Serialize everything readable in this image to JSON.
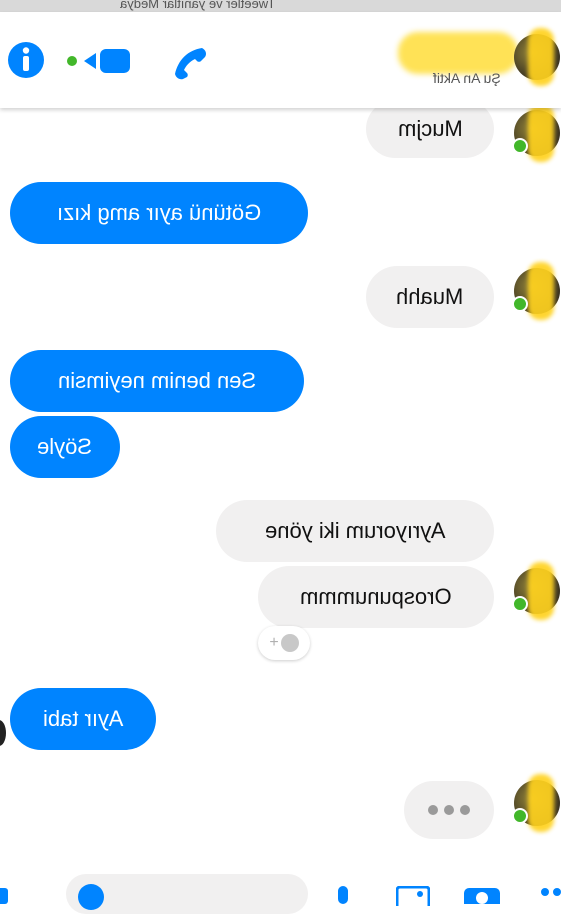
{
  "statusbar": {
    "ghost_text": "Tweetler ve yanıtlar   Medya"
  },
  "header": {
    "status_text": "Şu An Aktif",
    "icons": [
      "info-icon",
      "video-call-icon",
      "phone-icon"
    ],
    "accent": "#0084ff"
  },
  "messages": [
    {
      "id": "m1",
      "side": "in",
      "text": "Mucjm"
    },
    {
      "id": "m2",
      "side": "out",
      "text": "Götünü ayır amg kızı"
    },
    {
      "id": "m3",
      "side": "in",
      "text": "Muahh"
    },
    {
      "id": "m4",
      "side": "out",
      "text": "Sen benim neyimsin"
    },
    {
      "id": "m5",
      "side": "out",
      "text": "Söyle"
    },
    {
      "id": "m6",
      "side": "in",
      "text": "Ayrıyorum iki yöne"
    },
    {
      "id": "m7",
      "side": "in",
      "text": "Orospunummm"
    },
    {
      "id": "m8",
      "side": "out",
      "text": "Ayır tabi"
    }
  ],
  "reaction_button": {
    "label": "+"
  },
  "typing_indicator": true,
  "composer": {
    "icons": [
      "thumbs-up-icon",
      "emoji-icon",
      "mic-icon",
      "image-icon",
      "camera-icon",
      "apps-icon"
    ]
  },
  "colors": {
    "outgoing": "#0084ff",
    "incoming": "#f1f0f0",
    "online": "#42b72a"
  }
}
